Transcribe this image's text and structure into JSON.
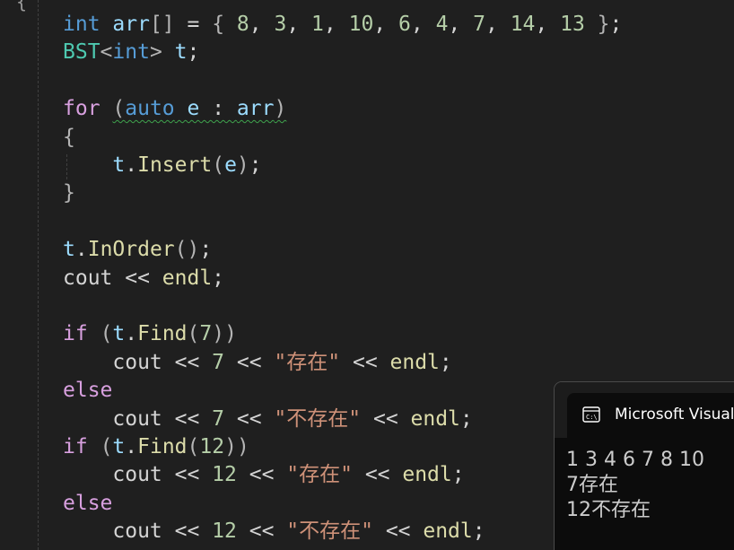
{
  "editor": {
    "top_fragment": "{",
    "lines": [
      {
        "tokens": [
          {
            "t": "int",
            "c": "kw"
          },
          {
            "t": " ",
            "c": "plain"
          },
          {
            "t": "arr",
            "c": "var"
          },
          {
            "t": "[]",
            "c": "punc"
          },
          {
            "t": " = ",
            "c": "plain"
          },
          {
            "t": "{",
            "c": "punc"
          },
          {
            "t": " 8",
            "c": "num"
          },
          {
            "t": ", ",
            "c": "plain"
          },
          {
            "t": "3",
            "c": "num"
          },
          {
            "t": ", ",
            "c": "plain"
          },
          {
            "t": "1",
            "c": "num"
          },
          {
            "t": ", ",
            "c": "plain"
          },
          {
            "t": "10",
            "c": "num"
          },
          {
            "t": ", ",
            "c": "plain"
          },
          {
            "t": "6",
            "c": "num"
          },
          {
            "t": ", ",
            "c": "plain"
          },
          {
            "t": "4",
            "c": "num"
          },
          {
            "t": ", ",
            "c": "plain"
          },
          {
            "t": "7",
            "c": "num"
          },
          {
            "t": ", ",
            "c": "plain"
          },
          {
            "t": "14",
            "c": "num"
          },
          {
            "t": ", ",
            "c": "plain"
          },
          {
            "t": "13",
            "c": "num"
          },
          {
            "t": " ",
            "c": "plain"
          },
          {
            "t": "}",
            "c": "punc"
          },
          {
            "t": ";",
            "c": "plain"
          }
        ]
      },
      {
        "tokens": [
          {
            "t": "BST",
            "c": "type"
          },
          {
            "t": "<",
            "c": "punc"
          },
          {
            "t": "int",
            "c": "kw"
          },
          {
            "t": ">",
            "c": "punc"
          },
          {
            "t": " ",
            "c": "plain"
          },
          {
            "t": "t",
            "c": "var"
          },
          {
            "t": ";",
            "c": "plain"
          }
        ]
      },
      {
        "tokens": []
      },
      {
        "tokens": [
          {
            "t": "for",
            "c": "ctrl"
          },
          {
            "t": " ",
            "c": "plain"
          },
          {
            "t": "(",
            "c": "punc",
            "squiggle": true
          },
          {
            "t": "auto",
            "c": "kw",
            "squiggle": true
          },
          {
            "t": " ",
            "c": "plain",
            "squiggle": true
          },
          {
            "t": "e",
            "c": "var",
            "squiggle": true
          },
          {
            "t": " : ",
            "c": "plain",
            "squiggle": true
          },
          {
            "t": "arr",
            "c": "var",
            "squiggle": true
          },
          {
            "t": ")",
            "c": "punc",
            "squiggle": true
          }
        ]
      },
      {
        "tokens": [
          {
            "t": "{",
            "c": "punc"
          }
        ]
      },
      {
        "tokens": [
          {
            "t": "    ",
            "c": "plain"
          },
          {
            "t": "t",
            "c": "var"
          },
          {
            "t": ".",
            "c": "plain"
          },
          {
            "t": "Insert",
            "c": "fn"
          },
          {
            "t": "(",
            "c": "punc"
          },
          {
            "t": "e",
            "c": "var"
          },
          {
            "t": ")",
            "c": "punc"
          },
          {
            "t": ";",
            "c": "plain"
          }
        ]
      },
      {
        "tokens": [
          {
            "t": "}",
            "c": "punc"
          }
        ]
      },
      {
        "tokens": []
      },
      {
        "tokens": [
          {
            "t": "t",
            "c": "var"
          },
          {
            "t": ".",
            "c": "plain"
          },
          {
            "t": "InOrder",
            "c": "fn"
          },
          {
            "t": "()",
            "c": "punc"
          },
          {
            "t": ";",
            "c": "plain"
          }
        ]
      },
      {
        "tokens": [
          {
            "t": "cout",
            "c": "plain"
          },
          {
            "t": " << ",
            "c": "plain"
          },
          {
            "t": "endl",
            "c": "fn"
          },
          {
            "t": ";",
            "c": "plain"
          }
        ]
      },
      {
        "tokens": []
      },
      {
        "tokens": [
          {
            "t": "if",
            "c": "ctrl"
          },
          {
            "t": " ",
            "c": "plain"
          },
          {
            "t": "(",
            "c": "punc"
          },
          {
            "t": "t",
            "c": "var"
          },
          {
            "t": ".",
            "c": "plain"
          },
          {
            "t": "Find",
            "c": "fn"
          },
          {
            "t": "(",
            "c": "punc"
          },
          {
            "t": "7",
            "c": "num"
          },
          {
            "t": "))",
            "c": "punc"
          }
        ]
      },
      {
        "tokens": [
          {
            "t": "    ",
            "c": "plain"
          },
          {
            "t": "cout",
            "c": "plain"
          },
          {
            "t": " << ",
            "c": "plain"
          },
          {
            "t": "7",
            "c": "num"
          },
          {
            "t": " << ",
            "c": "plain"
          },
          {
            "t": "\"存在\"",
            "c": "str"
          },
          {
            "t": " << ",
            "c": "plain"
          },
          {
            "t": "endl",
            "c": "fn"
          },
          {
            "t": ";",
            "c": "plain"
          }
        ]
      },
      {
        "tokens": [
          {
            "t": "else",
            "c": "ctrl"
          }
        ]
      },
      {
        "tokens": [
          {
            "t": "    ",
            "c": "plain"
          },
          {
            "t": "cout",
            "c": "plain"
          },
          {
            "t": " << ",
            "c": "plain"
          },
          {
            "t": "7",
            "c": "num"
          },
          {
            "t": " << ",
            "c": "plain"
          },
          {
            "t": "\"不存在\"",
            "c": "str"
          },
          {
            "t": " << ",
            "c": "plain"
          },
          {
            "t": "endl",
            "c": "fn"
          },
          {
            "t": ";",
            "c": "plain"
          }
        ]
      },
      {
        "tokens": [
          {
            "t": "if",
            "c": "ctrl"
          },
          {
            "t": " ",
            "c": "plain"
          },
          {
            "t": "(",
            "c": "punc"
          },
          {
            "t": "t",
            "c": "var"
          },
          {
            "t": ".",
            "c": "plain"
          },
          {
            "t": "Find",
            "c": "fn"
          },
          {
            "t": "(",
            "c": "punc"
          },
          {
            "t": "12",
            "c": "num"
          },
          {
            "t": "))",
            "c": "punc"
          }
        ]
      },
      {
        "tokens": [
          {
            "t": "    ",
            "c": "plain"
          },
          {
            "t": "cout",
            "c": "plain"
          },
          {
            "t": " << ",
            "c": "plain"
          },
          {
            "t": "12",
            "c": "num"
          },
          {
            "t": " << ",
            "c": "plain"
          },
          {
            "t": "\"存在\"",
            "c": "str"
          },
          {
            "t": " << ",
            "c": "plain"
          },
          {
            "t": "endl",
            "c": "fn"
          },
          {
            "t": ";",
            "c": "plain"
          }
        ]
      },
      {
        "tokens": [
          {
            "t": "else",
            "c": "ctrl"
          }
        ]
      },
      {
        "tokens": [
          {
            "t": "    ",
            "c": "plain"
          },
          {
            "t": "cout",
            "c": "plain"
          },
          {
            "t": " << ",
            "c": "plain"
          },
          {
            "t": "12",
            "c": "num"
          },
          {
            "t": " << ",
            "c": "plain"
          },
          {
            "t": "\"不存在\"",
            "c": "str"
          },
          {
            "t": " << ",
            "c": "plain"
          },
          {
            "t": "endl",
            "c": "fn"
          },
          {
            "t": ";",
            "c": "plain"
          }
        ]
      }
    ]
  },
  "console": {
    "title": "Microsoft Visual",
    "icon": "console-window-icon",
    "output": [
      "1 3 4 6 7 8 10",
      "7存在",
      "12不存在"
    ]
  }
}
